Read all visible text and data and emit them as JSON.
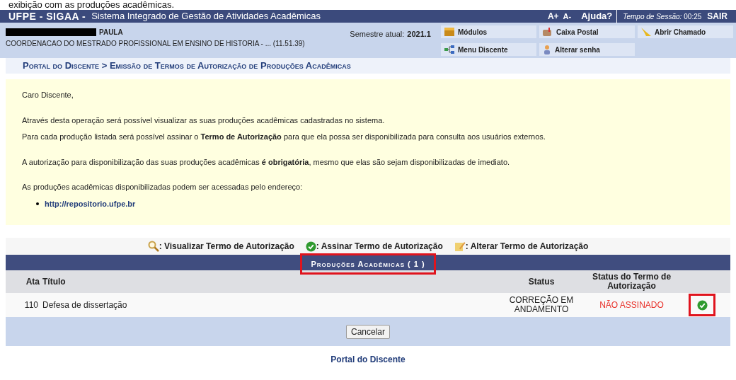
{
  "caption": "exibição com as produções acadêmicas.",
  "header": {
    "brand": "UFPE - SIGAA -",
    "system": "Sistema Integrado de Gestão de Atividades Acadêmicas",
    "font_up": "A+",
    "font_down": "A-",
    "help": "Ajuda?",
    "session_label": "Tempo de Sessão:",
    "session_time": "00:25",
    "logout": "SAIR"
  },
  "user": {
    "name": "PAULA",
    "unit": "COORDENACAO DO MESTRADO PROFISSIONAL EM ENSINO DE HISTORIA - ... (11.51.39)",
    "semester_label": "Semestre atual:",
    "semester": "2021.1"
  },
  "menu": [
    {
      "label": "Módulos",
      "kind": "modules"
    },
    {
      "label": "Caixa Postal",
      "kind": "mail"
    },
    {
      "label": "Abrir Chamado",
      "kind": "ticket"
    },
    {
      "label": "Menu Discente",
      "kind": "menu"
    },
    {
      "label": "Alterar senha",
      "kind": "user"
    }
  ],
  "breadcrumb": "Portal do Discente > Emissão de Termos de Autorização de Produções Acadêmicas",
  "info": [
    "Caro Discente,",
    "Através desta operação será possível visualizar as suas produções acadêmicas cadastradas no sistema.",
    "Para cada produção listada será possível assinar o **Termo de Autorização** para que ela possa ser disponibilizada para consulta aos usuários externos.",
    "A autorização para disponibilização das suas produções acadêmicas **é obrigatória**, mesmo que elas são sejam disponibilizadas de imediato.",
    "As produções acadêmicas disponibilizadas podem ser acessadas pelo endereço:"
  ],
  "link": "http://repositorio.ufpe.br",
  "legend": [
    {
      "kind": "view",
      "label": ": Visualizar Termo de Autorização"
    },
    {
      "kind": "sign",
      "label": ": Assinar Termo de Autorização"
    },
    {
      "kind": "edit",
      "label": ": Alterar Termo de Autorização"
    }
  ],
  "table": {
    "title": "Produções Acadêmicas ( 1 )",
    "columns": [
      "Ata",
      "Título",
      "Status",
      "Status do Termo de Autorização"
    ],
    "rows": [
      {
        "ata": "110",
        "title": "Defesa de dissertação",
        "status": "CORREÇÃO EM ANDAMENTO",
        "term_status": "NÃO ASSINADO"
      }
    ]
  },
  "cancel": "Cancelar",
  "footer_link": "Portal do Discente"
}
